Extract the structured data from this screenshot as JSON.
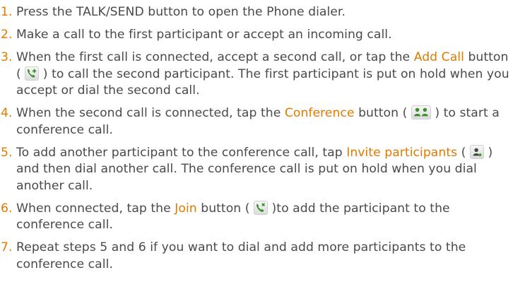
{
  "steps": [
    {
      "number": "1.",
      "parts": [
        {
          "text": "Press the TALK/SEND button to open the Phone dialer."
        }
      ]
    },
    {
      "number": "2.",
      "parts": [
        {
          "text": "Make a call to the first participant or accept an incoming call."
        }
      ]
    },
    {
      "number": "3.",
      "parts": [
        {
          "text": "When the first call is connected, accept a second call, or tap the "
        },
        {
          "term": "Add Call"
        },
        {
          "text": " button ( "
        },
        {
          "icon": "add-call-icon"
        },
        {
          "text": " ) to call the second participant. The first participant is put on hold when you accept or dial the second call."
        }
      ]
    },
    {
      "number": "4.",
      "parts": [
        {
          "text": "When the second call is connected, tap the "
        },
        {
          "term": "Conference"
        },
        {
          "text": " button ( "
        },
        {
          "icon": "conference-icon"
        },
        {
          "text": " ) to start a conference call."
        }
      ]
    },
    {
      "number": "5.",
      "parts": [
        {
          "text": "To add another participant to the conference call, tap "
        },
        {
          "term": "Invite participants"
        },
        {
          "text": " ( "
        },
        {
          "icon": "invite-participants-icon"
        },
        {
          "text": " ) and then dial another call. The conference call is put on hold when you dial another call."
        }
      ]
    },
    {
      "number": "6.",
      "parts": [
        {
          "text": "When connected, tap the "
        },
        {
          "term": "Join"
        },
        {
          "text": " button ( "
        },
        {
          "icon": "join-call-icon"
        },
        {
          "text": " )to add the participant to the conference call."
        }
      ]
    },
    {
      "number": "7.",
      "parts": [
        {
          "text": "Repeat steps 5 and 6 if you want to dial and add more participants to the conference call."
        }
      ]
    }
  ],
  "colors": {
    "accent": "#e07a00",
    "body_text": "#4a4a4a",
    "icon_green": "#3a8f2a"
  }
}
